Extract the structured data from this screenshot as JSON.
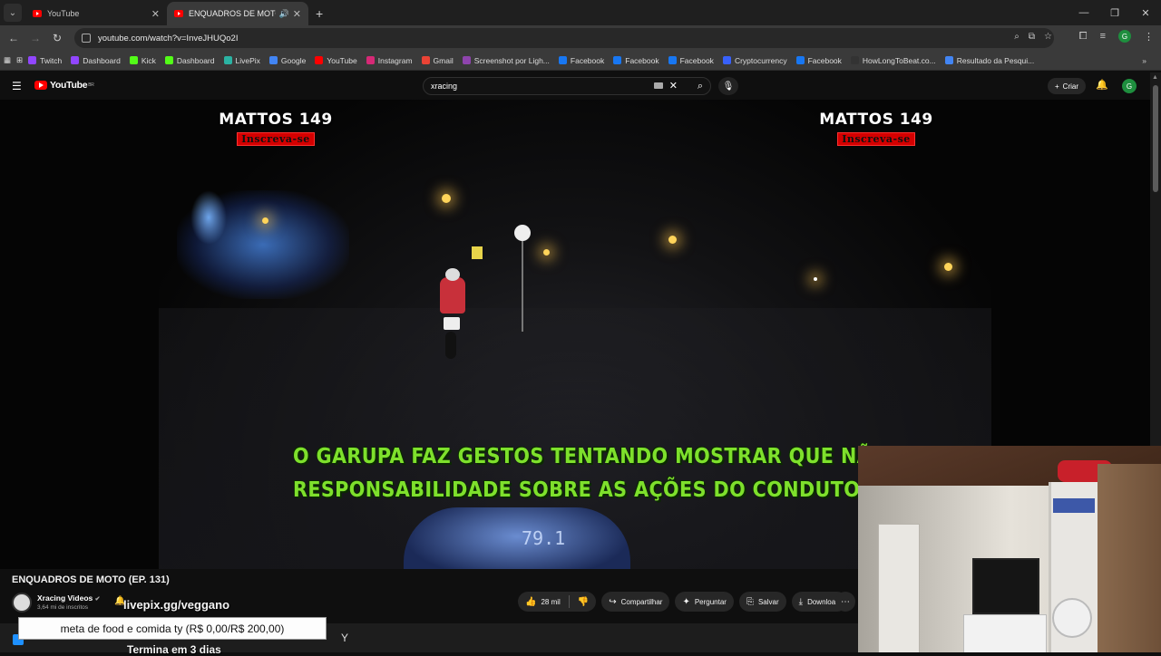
{
  "browser": {
    "tabs": [
      {
        "title": "YouTube",
        "active": false
      },
      {
        "title": "ENQUADROS DE MOTO (EP.",
        "active": true
      }
    ],
    "url": "youtube.com/watch?v=InveJHUQo2I",
    "bookmarks": [
      {
        "label": "Twitch",
        "color": "#9146ff"
      },
      {
        "label": "Dashboard",
        "color": "#9146ff"
      },
      {
        "label": "Kick",
        "color": "#53fc18"
      },
      {
        "label": "Dashboard",
        "color": "#53fc18"
      },
      {
        "label": "LivePix",
        "color": "#2bb3a3"
      },
      {
        "label": "Google",
        "color": "#4285f4"
      },
      {
        "label": "YouTube",
        "color": "#ff0000"
      },
      {
        "label": "Instagram",
        "color": "#d62976"
      },
      {
        "label": "Gmail",
        "color": "#ea4335"
      },
      {
        "label": "Screenshot por Ligh...",
        "color": "#8e44ad"
      },
      {
        "label": "Facebook",
        "color": "#1877f2"
      },
      {
        "label": "Facebook",
        "color": "#1877f2"
      },
      {
        "label": "Facebook",
        "color": "#1877f2"
      },
      {
        "label": "Cryptocurrency",
        "color": "#3861fb"
      },
      {
        "label": "Facebook",
        "color": "#1877f2"
      },
      {
        "label": "HowLongToBeat.co...",
        "color": "#333333"
      },
      {
        "label": "Resultado da Pesqui...",
        "color": "#4285f4"
      }
    ],
    "profile_initial": "G"
  },
  "youtube": {
    "logo_text": "YouTube",
    "logo_region": "BR",
    "search_value": "xracing",
    "create_label": "Criar",
    "avatar_initial": "G"
  },
  "video": {
    "brand_left": "MATTOS 149",
    "brand_left_sub": "Inscreva-se",
    "brand_right": "MATTOS 149",
    "brand_right_sub": "Inscreva-se",
    "caption_line1": "O GARUPA FAZ GESTOS TENTANDO MOSTRAR QUE NÃO TEM",
    "caption_line2": "RESPONSABILIDADE SOBRE AS AÇÕES DO CONDUTOR DA MOTO...",
    "dash_number": "79.1"
  },
  "meta": {
    "title": "ENQUADROS DE MOTO (EP. 131)",
    "channel": "Xracing Videos",
    "subscribers": "3,64 mi de inscritos",
    "likes": "28 mil",
    "share": "Compartilhar",
    "ask": "Perguntar",
    "save": "Salvar",
    "download": "Download"
  },
  "stream_overlay": {
    "livepix": "livepix.gg/veggano",
    "goal": "meta de food e comida ty (R$ 0,00/R$ 200,00)",
    "ends": "Termina em 3 dias"
  }
}
